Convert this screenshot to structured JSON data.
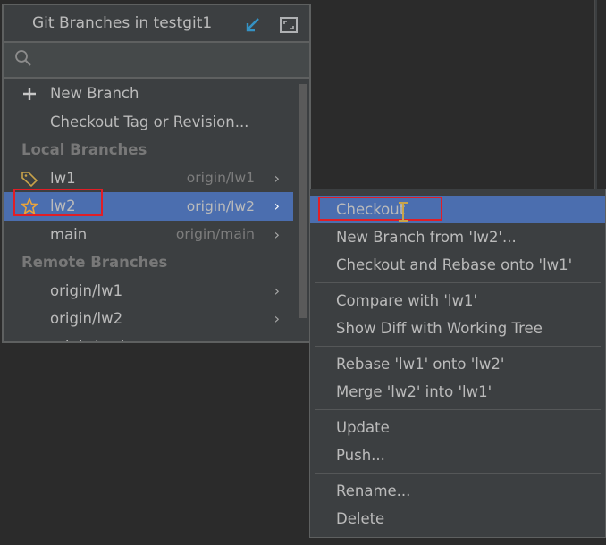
{
  "popup": {
    "title": "Git Branches in testgit1",
    "icons": {
      "fetch": "fetch-arrow-icon",
      "expand": "expand-window-icon"
    },
    "search": {
      "value": "",
      "placeholder": ""
    },
    "actions": [
      {
        "label": "New Branch",
        "icon": "plus-icon"
      },
      {
        "label": "Checkout Tag or Revision..."
      }
    ],
    "local_section": "Local Branches",
    "local_branches": [
      {
        "name": "lw1",
        "remote": "origin/lw1",
        "icon": "tag-icon",
        "selected": false
      },
      {
        "name": "lw2",
        "remote": "origin/lw2",
        "icon": "star-icon",
        "selected": true
      },
      {
        "name": "main",
        "remote": "origin/main",
        "icon": "",
        "selected": false
      }
    ],
    "remote_section": "Remote Branches",
    "remote_branches": [
      {
        "name": "origin/lw1"
      },
      {
        "name": "origin/lw2"
      },
      {
        "name": "origin/main"
      }
    ]
  },
  "context_menu": {
    "groups": [
      [
        "Checkout",
        "New Branch from 'lw2'...",
        "Checkout and Rebase onto 'lw1'"
      ],
      [
        "Compare with 'lw1'",
        "Show Diff with Working Tree"
      ],
      [
        "Rebase 'lw1' onto 'lw2'",
        "Merge 'lw2' into 'lw1'"
      ],
      [
        "Update",
        "Push..."
      ],
      [
        "Rename...",
        "Delete"
      ]
    ],
    "selected": "Checkout"
  },
  "colors": {
    "selection": "#4b6eaf",
    "highlight_box": "#e01e26",
    "accent_icon": "#3592c4",
    "star": "#e8a33d"
  }
}
